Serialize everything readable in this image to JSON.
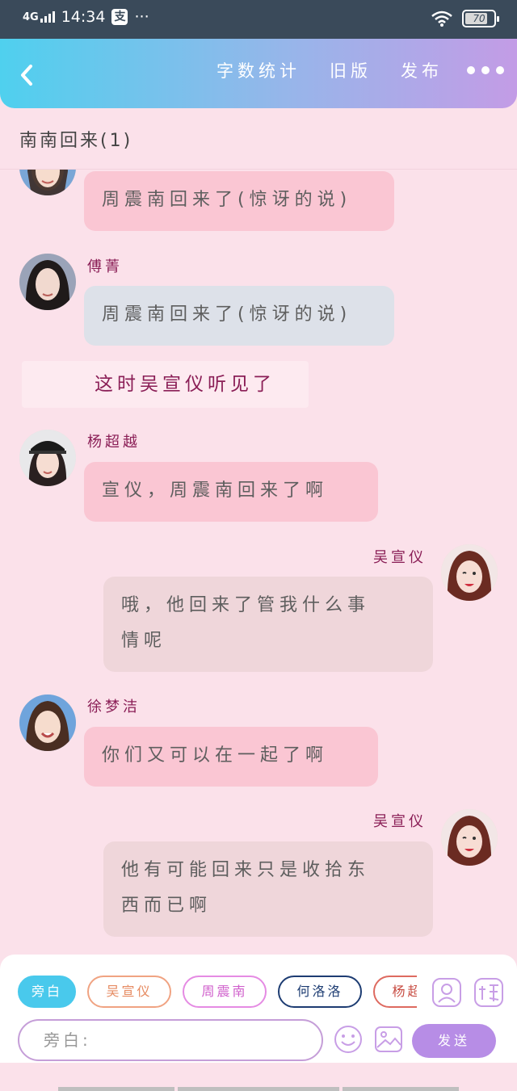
{
  "status_bar": {
    "network": "4G",
    "time": "14:34",
    "app_badge": "支",
    "more": "···",
    "battery": "70"
  },
  "header": {
    "actions": [
      "字数统计",
      "旧版",
      "发布"
    ]
  },
  "story_title": "南南回来(1)",
  "messages": [
    {
      "name": "",
      "text": "周震南回来了(惊讶的说)"
    },
    {
      "name": "傅菁",
      "text": "周震南回来了(惊讶的说)"
    },
    {
      "narration": "这时吴宣仪听见了"
    },
    {
      "name": "杨超越",
      "text": "宣仪，周震南回来了啊"
    },
    {
      "name": "吴宣仪",
      "line1": "哦，他回来了管我什么事",
      "line2": "情呢"
    },
    {
      "name": "徐梦洁",
      "text": "你们又可以在一起了啊"
    },
    {
      "name": "吴宣仪",
      "line1": "他有可能回来只是收拾东",
      "line2": "西而已啊"
    }
  ],
  "composer": {
    "chips": [
      "旁白",
      "吴宣仪",
      "周震南",
      "何洛洛",
      "杨超越"
    ],
    "placeholder": "旁白:",
    "send_label": "发送"
  },
  "colors": {
    "background": "#fbe1ea",
    "header_gradient_start": "#4fd0ee",
    "header_gradient_end": "#c39ce6",
    "name_color": "#8a1e56",
    "bubble_pink": "#fac6d3",
    "bubble_blue": "#dde1e9",
    "send_button": "#b78de6"
  }
}
